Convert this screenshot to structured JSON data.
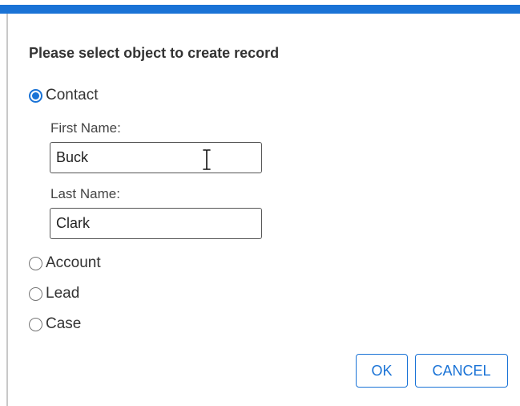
{
  "dialog": {
    "heading": "Please select object to create record",
    "objects": [
      {
        "label": "Contact",
        "selected": true
      },
      {
        "label": "Account",
        "selected": false
      },
      {
        "label": "Lead",
        "selected": false
      },
      {
        "label": "Case",
        "selected": false
      }
    ],
    "contact_form": {
      "first_name_label": "First Name:",
      "first_name_value": "Buck",
      "last_name_label": "Last Name:",
      "last_name_value": "Clark"
    },
    "buttons": {
      "ok": "OK",
      "cancel": "CANCEL"
    }
  },
  "colors": {
    "accent": "#1a73d6",
    "text": "#333333",
    "border": "#555555"
  }
}
